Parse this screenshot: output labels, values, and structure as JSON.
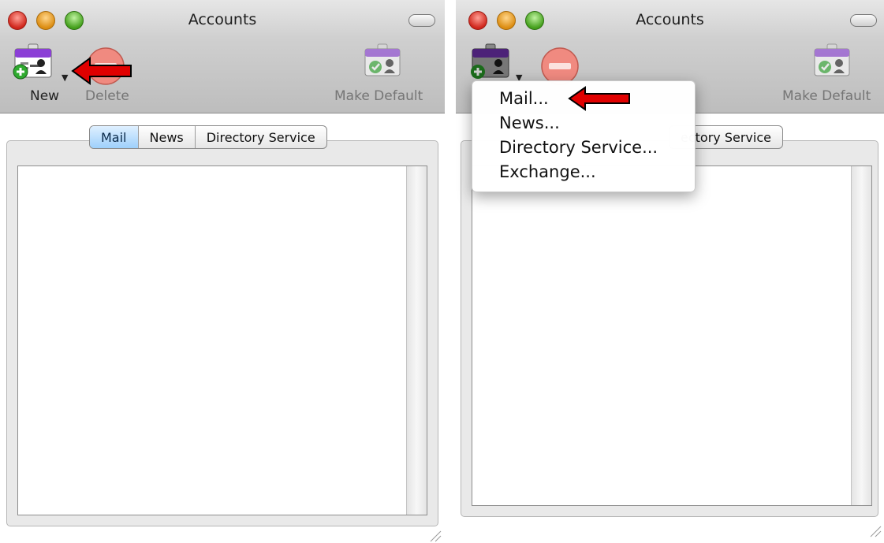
{
  "left_window": {
    "title": "Accounts",
    "toolbar": {
      "new_label": "New",
      "delete_label": "Delete",
      "make_default_label": "Make Default"
    },
    "tabs": [
      {
        "label": "Mail",
        "selected": true
      },
      {
        "label": "News",
        "selected": false
      },
      {
        "label": "Directory Service",
        "selected": false
      }
    ]
  },
  "right_window": {
    "title": "Accounts",
    "toolbar": {
      "make_default_label": "Make Default"
    },
    "visible_tab_fragment": "ectory Service",
    "new_menu": {
      "items": [
        "Mail...",
        "News...",
        "Directory Service...",
        "Exchange..."
      ]
    }
  },
  "colors": {
    "annotation_arrow": "#e00000",
    "selected_tab": "#9ed0fb"
  },
  "icons": {
    "new": "new-account-card-icon",
    "delete": "delete-icon",
    "make_default": "default-account-card-icon",
    "dropdown": "dropdown-triangle-icon"
  }
}
